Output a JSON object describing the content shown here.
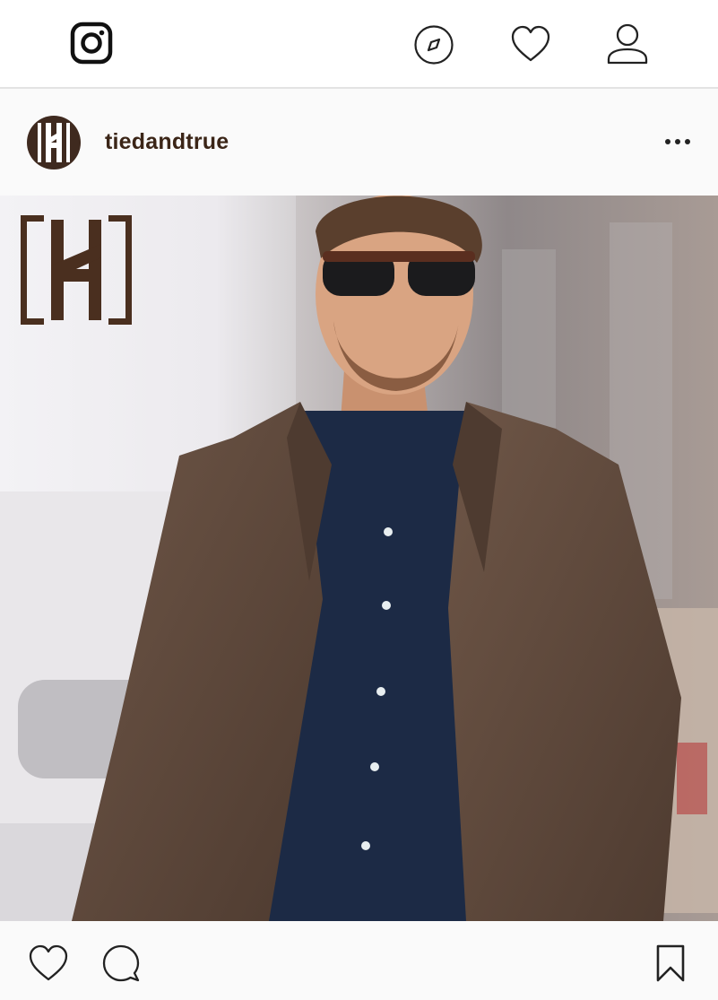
{
  "app": {
    "icons": {
      "logo": "instagram-logo-icon",
      "explore": "compass-icon",
      "activity": "heart-icon",
      "profile": "user-icon"
    }
  },
  "post": {
    "username": "tiedandtrue",
    "avatar": "brand-logo-avatar",
    "more": "more-options-icon",
    "image": {
      "description_icon": "man-in-brown-blazer-photo",
      "brand_mark": "tied-and-true-logo"
    },
    "actions": {
      "like": "heart-icon",
      "comment": "comment-bubble-icon",
      "save": "bookmark-icon"
    }
  },
  "colors": {
    "brand_brown": "#4a2f1f",
    "username": "#3b2517",
    "icon": "#222222",
    "divider": "#e3e3e3",
    "panel": "#fafafa"
  }
}
